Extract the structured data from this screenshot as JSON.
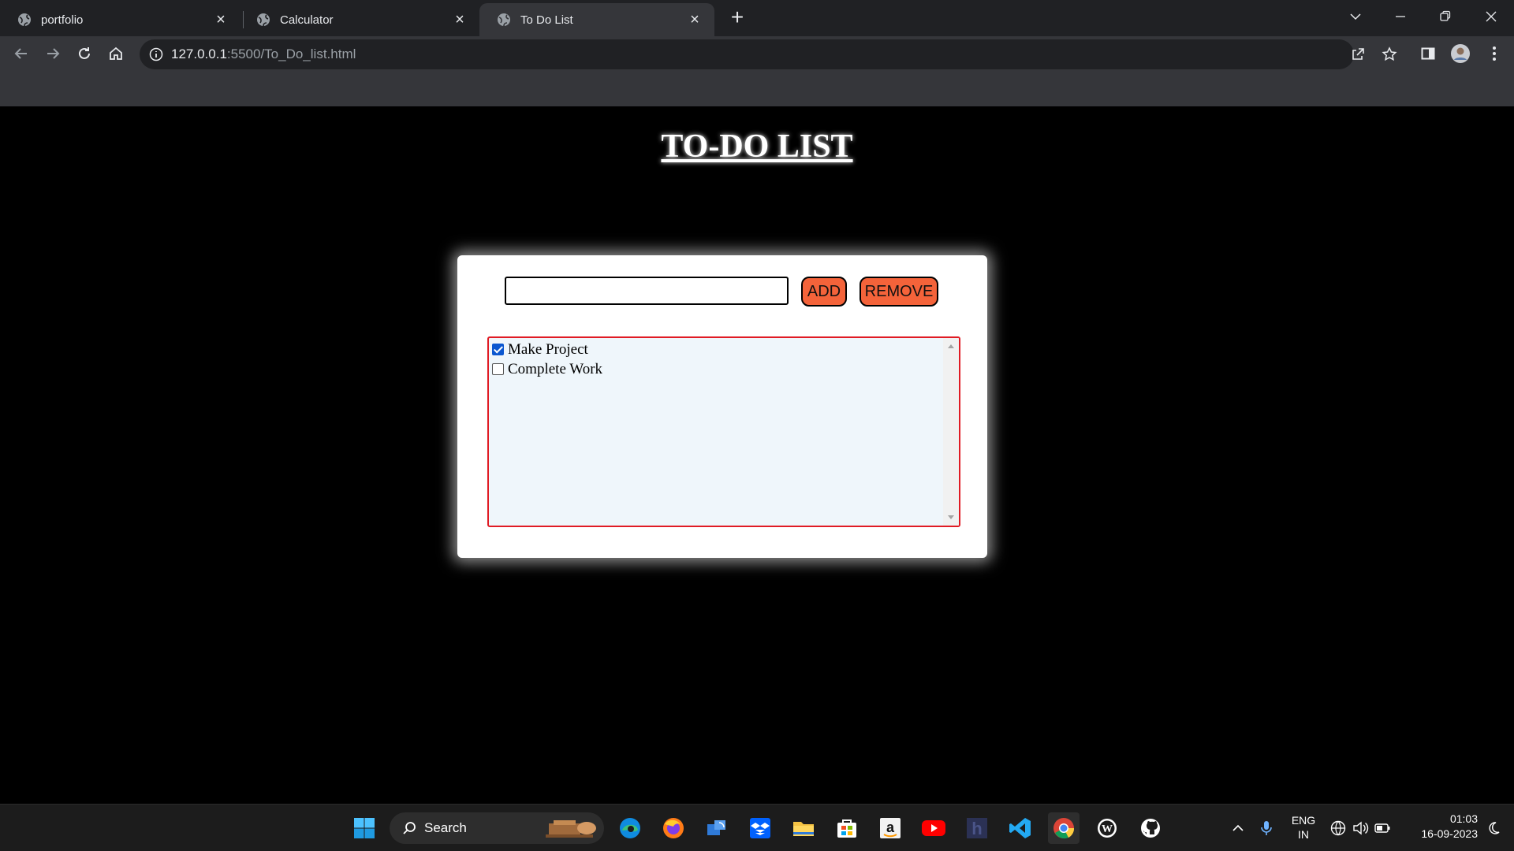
{
  "browser": {
    "tabs": [
      {
        "title": "portfolio",
        "active": false
      },
      {
        "title": "Calculator",
        "active": false
      },
      {
        "title": "To Do List",
        "active": true
      }
    ],
    "url_host": "127.0.0.1",
    "url_rest": ":5500/To_Do_list.html"
  },
  "page": {
    "title": "TO-DO LIST",
    "input_value": "",
    "add_label": "ADD",
    "remove_label": "REMOVE",
    "tasks": [
      {
        "label": "Make Project",
        "checked": true
      },
      {
        "label": "Complete Work",
        "checked": false
      }
    ],
    "colors": {
      "button": "#f4633a",
      "list_border": "#e01b24",
      "list_bg": "#eff6fb"
    }
  },
  "taskbar": {
    "search_label": "Search",
    "language": "ENG",
    "region": "IN",
    "time": "01:03",
    "date": "16-09-2023"
  }
}
